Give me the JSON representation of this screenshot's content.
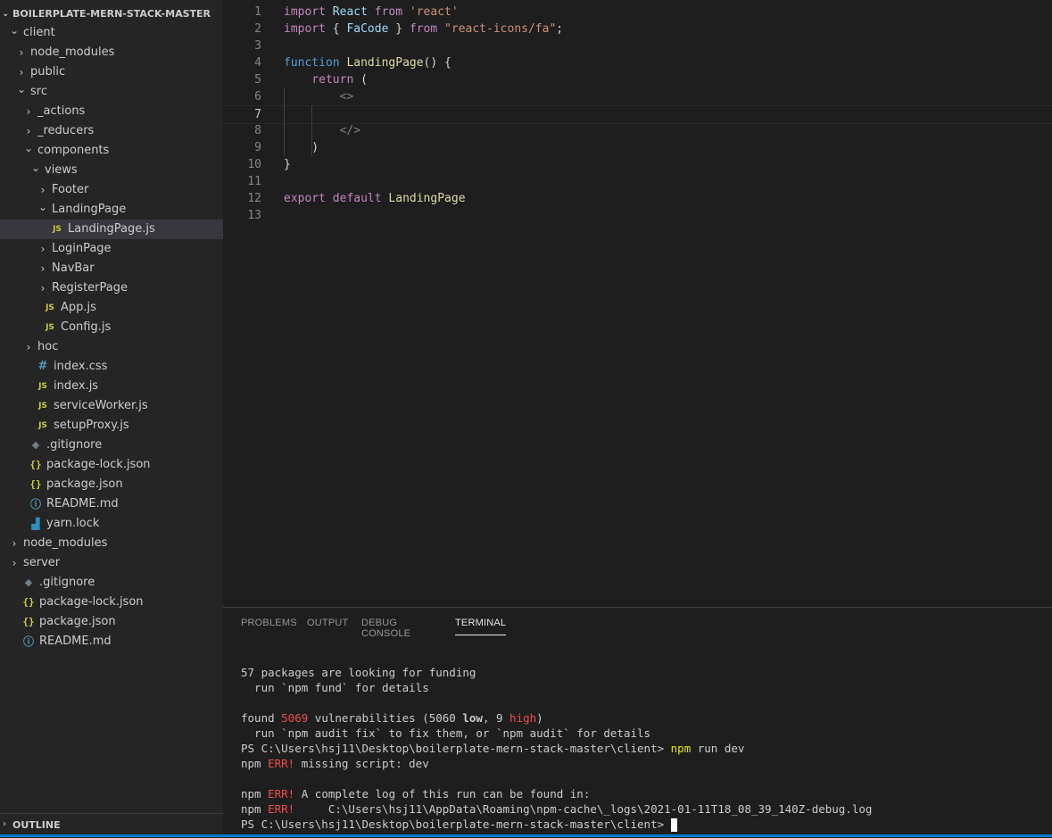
{
  "explorer": {
    "title": "BOILERPLATE-MERN-STACK-MASTER",
    "tree": [
      {
        "label": "client",
        "depth": 0,
        "type": "folder",
        "expanded": true
      },
      {
        "label": "node_modules",
        "depth": 1,
        "type": "folder",
        "expanded": false
      },
      {
        "label": "public",
        "depth": 1,
        "type": "folder",
        "expanded": false
      },
      {
        "label": "src",
        "depth": 1,
        "type": "folder",
        "expanded": true
      },
      {
        "label": "_actions",
        "depth": 2,
        "type": "folder",
        "expanded": false
      },
      {
        "label": "_reducers",
        "depth": 2,
        "type": "folder",
        "expanded": false
      },
      {
        "label": "components",
        "depth": 2,
        "type": "folder",
        "expanded": true
      },
      {
        "label": "views",
        "depth": 3,
        "type": "folder",
        "expanded": true
      },
      {
        "label": "Footer",
        "depth": 4,
        "type": "folder",
        "expanded": false
      },
      {
        "label": "LandingPage",
        "depth": 4,
        "type": "folder",
        "expanded": true
      },
      {
        "label": "LandingPage.js",
        "depth": 5,
        "type": "js",
        "selected": true
      },
      {
        "label": "LoginPage",
        "depth": 4,
        "type": "folder",
        "expanded": false
      },
      {
        "label": "NavBar",
        "depth": 4,
        "type": "folder",
        "expanded": false
      },
      {
        "label": "RegisterPage",
        "depth": 4,
        "type": "folder",
        "expanded": false
      },
      {
        "label": "App.js",
        "depth": 4,
        "type": "js"
      },
      {
        "label": "Config.js",
        "depth": 4,
        "type": "js"
      },
      {
        "label": "hoc",
        "depth": 2,
        "type": "folder",
        "expanded": false
      },
      {
        "label": "index.css",
        "depth": 3,
        "type": "css"
      },
      {
        "label": "index.js",
        "depth": 3,
        "type": "js"
      },
      {
        "label": "serviceWorker.js",
        "depth": 3,
        "type": "js"
      },
      {
        "label": "setupProxy.js",
        "depth": 3,
        "type": "js"
      },
      {
        "label": ".gitignore",
        "depth": 2,
        "type": "git"
      },
      {
        "label": "package-lock.json",
        "depth": 2,
        "type": "json"
      },
      {
        "label": "package.json",
        "depth": 2,
        "type": "json"
      },
      {
        "label": "README.md",
        "depth": 2,
        "type": "info"
      },
      {
        "label": "yarn.lock",
        "depth": 2,
        "type": "yarn"
      },
      {
        "label": "node_modules",
        "depth": 0,
        "type": "folder",
        "expanded": false
      },
      {
        "label": "server",
        "depth": 0,
        "type": "folder",
        "expanded": false
      },
      {
        "label": ".gitignore",
        "depth": 1,
        "type": "git"
      },
      {
        "label": "package-lock.json",
        "depth": 1,
        "type": "json"
      },
      {
        "label": "package.json",
        "depth": 1,
        "type": "json"
      },
      {
        "label": "README.md",
        "depth": 1,
        "type": "info"
      }
    ],
    "outline_label": "OUTLINE"
  },
  "editor": {
    "lines": [
      {
        "n": "1",
        "tokens": [
          [
            "kw2",
            "import"
          ],
          [
            "plain",
            " "
          ],
          [
            "var",
            "React"
          ],
          [
            "plain",
            " "
          ],
          [
            "kw2",
            "from"
          ],
          [
            "plain",
            " "
          ],
          [
            "str",
            "'react'"
          ]
        ]
      },
      {
        "n": "2",
        "tokens": [
          [
            "kw2",
            "import"
          ],
          [
            "plain",
            " { "
          ],
          [
            "var",
            "FaCode"
          ],
          [
            "plain",
            " } "
          ],
          [
            "kw2",
            "from"
          ],
          [
            "plain",
            " "
          ],
          [
            "str",
            "\"react-icons/fa\""
          ],
          [
            "plain",
            ";"
          ]
        ]
      },
      {
        "n": "3",
        "tokens": []
      },
      {
        "n": "4",
        "tokens": [
          [
            "kw",
            "function"
          ],
          [
            "plain",
            " "
          ],
          [
            "fn",
            "LandingPage"
          ],
          [
            "plain",
            "() {"
          ]
        ]
      },
      {
        "n": "5",
        "tokens": [
          [
            "plain",
            "    "
          ],
          [
            "kw2",
            "return"
          ],
          [
            "plain",
            " ("
          ]
        ]
      },
      {
        "n": "6",
        "tokens": [
          [
            "plain",
            "        "
          ],
          [
            "tag",
            "<>"
          ]
        ]
      },
      {
        "n": "7",
        "tokens": [],
        "active": true
      },
      {
        "n": "8",
        "tokens": [
          [
            "plain",
            "        "
          ],
          [
            "tag",
            "</>"
          ]
        ]
      },
      {
        "n": "9",
        "tokens": [
          [
            "plain",
            "    )"
          ]
        ]
      },
      {
        "n": "10",
        "tokens": [
          [
            "plain",
            "}"
          ]
        ]
      },
      {
        "n": "11",
        "tokens": []
      },
      {
        "n": "12",
        "tokens": [
          [
            "kw2",
            "export"
          ],
          [
            "plain",
            " "
          ],
          [
            "kw2",
            "default"
          ],
          [
            "plain",
            " "
          ],
          [
            "fn",
            "LandingPage"
          ]
        ]
      },
      {
        "n": "13",
        "tokens": []
      }
    ]
  },
  "panel": {
    "tabs": [
      "PROBLEMS",
      "OUTPUT",
      "DEBUG CONSOLE",
      "TERMINAL"
    ],
    "active_tab": "TERMINAL",
    "terminal_lines": [
      [
        [
          "n",
          "57 packages are looking for funding"
        ]
      ],
      [
        [
          "n",
          "  run `npm fund` for details"
        ]
      ],
      [],
      [
        [
          "n",
          "found "
        ],
        [
          "r",
          "5069"
        ],
        [
          "n",
          " vulnerabilities (5060 "
        ],
        [
          "b",
          "low"
        ],
        [
          "n",
          ", 9 "
        ],
        [
          "r",
          "high"
        ],
        [
          "n",
          ")"
        ]
      ],
      [
        [
          "n",
          "  run `npm audit fix` to fix them, or `npm audit` for details"
        ]
      ],
      [
        [
          "n",
          "PS C:\\Users\\hsj11\\Desktop\\boilerplate-mern-stack-master\\client> "
        ],
        [
          "y",
          "npm"
        ],
        [
          "n",
          " run dev"
        ]
      ],
      [
        [
          "n",
          "npm "
        ],
        [
          "r",
          "ERR!"
        ],
        [
          "n",
          " missing script: dev"
        ]
      ],
      [],
      [
        [
          "n",
          "npm "
        ],
        [
          "r",
          "ERR!"
        ],
        [
          "n",
          " A complete log of this run can be found in:"
        ]
      ],
      [
        [
          "n",
          "npm "
        ],
        [
          "r",
          "ERR!"
        ],
        [
          "n",
          "     C:\\Users\\hsj11\\AppData\\Roaming\\npm-cache\\_logs\\2021-01-11T18_08_39_140Z-debug.log"
        ]
      ],
      [
        [
          "n",
          "PS C:\\Users\\hsj11\\Desktop\\boilerplate-mern-stack-master\\client> "
        ],
        [
          "cursor",
          ""
        ]
      ]
    ]
  },
  "colors": {
    "sidebar_bg": "#252526",
    "editor_bg": "#1e1e1e",
    "selection": "#37373d",
    "accent": "#007acc",
    "error": "#f14c4c",
    "command": "#e5e510"
  },
  "icons": {
    "folder_collapsed": "chevron-right-icon",
    "folder_expanded": "chevron-down-icon",
    "js": "js-file-icon",
    "json": "json-file-icon",
    "css": "css-file-icon",
    "info": "info-file-icon",
    "git": "git-file-icon",
    "yarn": "yarn-file-icon"
  }
}
